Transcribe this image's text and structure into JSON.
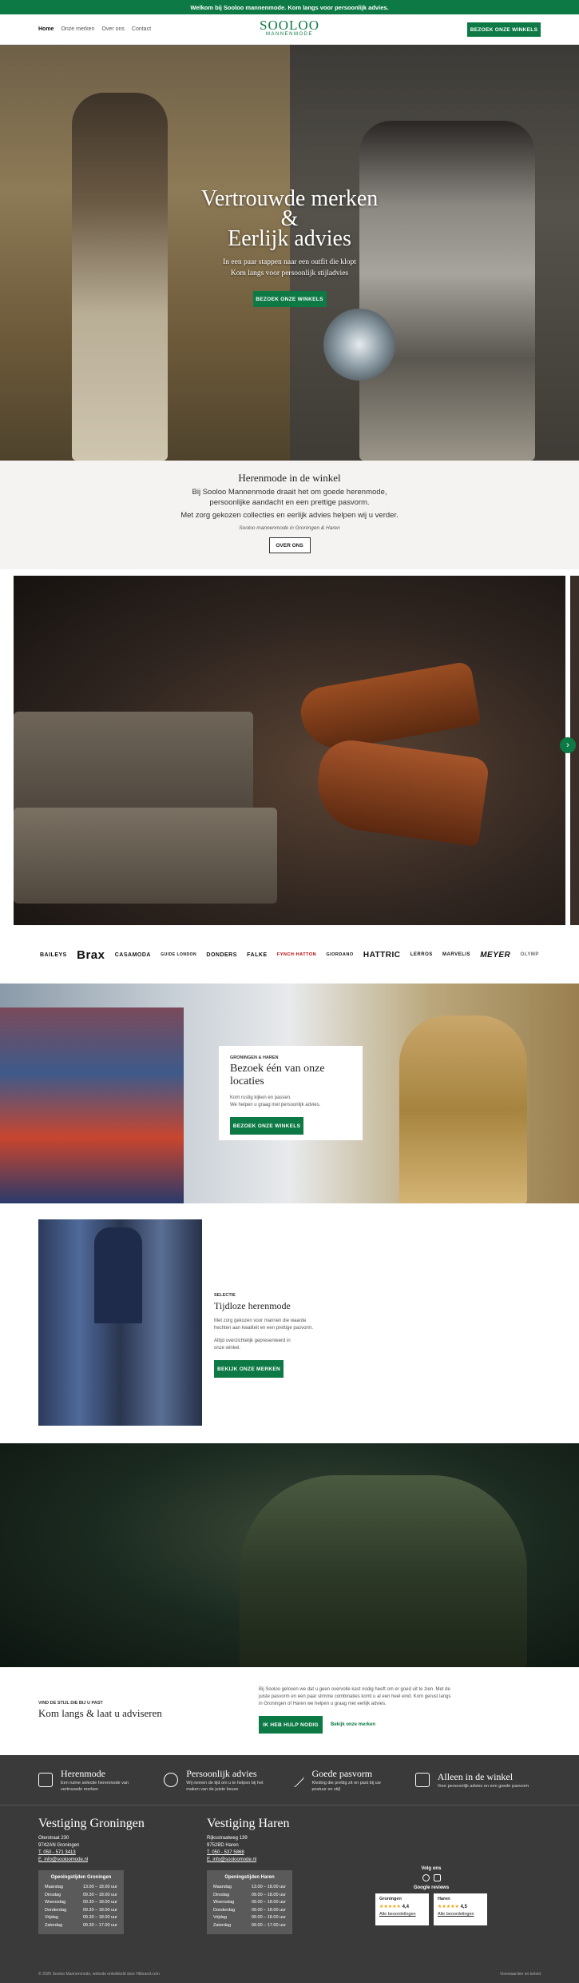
{
  "topbar": {
    "text": "Welkom bij Sooloo mannenmode. Kom langs voor persoonlijk advies."
  },
  "nav": {
    "links": [
      "Home",
      "Onze merken",
      "Over ons",
      "Contact"
    ],
    "logo_name": "SOOLOO",
    "logo_tagline": "MANNENMODE",
    "cta": "BEZOEK ONZE WINKELS"
  },
  "hero": {
    "title_l1": "Vertrouwde merken",
    "title_l2": "&",
    "title_l3": "Eerlijk advies",
    "sub_l1": "In een paar stappen naar een outfit die klopt",
    "sub_l2": "Kom langs voor persoonlijk stijladvies",
    "cta": "BEZOEK ONZE WINKELS"
  },
  "intro": {
    "heading": "Herenmode in de winkel",
    "p1": "Bij Sooloo Mannenmode draait het om goede herenmode,",
    "p2": "persoonlijke aandacht en een prettige pasvorm.",
    "p3": "Met zorg gekozen collecties en eerlijk advies helpen wij u verder.",
    "signature": "Sooloo mannenmode in Groningen & Haren",
    "cta": "OVER ONS"
  },
  "slider": {
    "next_arrow": "›"
  },
  "brands": [
    "BAILEYS",
    "Brax",
    "CASAMODA",
    "GUIDE LONDON",
    "DONDERS",
    "FALKE",
    "FYNCH·HATTON",
    "GIORDANO",
    "HATTRIC",
    "LERROS",
    "MARVELIS",
    "MEYER",
    "OLYMP"
  ],
  "visit": {
    "kicker": "GRONINGEN & HAREN",
    "heading": "Bezoek één van onze locaties",
    "p1": "Kom rustig kijken en passen.",
    "p2": "We helpen u graag met persoonlijk advies.",
    "cta": "BEZOEK ONZE WINKELS"
  },
  "feature": {
    "kicker": "SELECTIE",
    "heading": "Tijdloze herenmode",
    "p1": "Met zorg gekozen voor mannen die waarde",
    "p2": "hechten aan kwaliteit en een prettige pasvorm.",
    "p3": "Altijd overzichtelijk gepresenteerd in",
    "p4": "onze winkel.",
    "cta": "BEKIJK ONZE MERKEN"
  },
  "advice": {
    "kicker": "VIND DE STIJL DIE BIJ U PAST",
    "heading": "Kom langs & laat u adviseren",
    "p1": "Bij Sooloo geloven we dat u geen overvolle kast nodig heeft om er goed uit te zien. Met de",
    "p2": "juiste pasvorm en een paar slimme combinaties komt u al een heel eind. Kom gerust langs",
    "p3": "in Groningen of Haren we helpen u graag met eerlijk advies.",
    "cta": "IK HEB HULP NODIG",
    "link": "Bekijk onze merken"
  },
  "usps": [
    {
      "title": "Herenmode",
      "desc1": "Een ruime selectie herenmode van",
      "desc2": "vertrouwde merken"
    },
    {
      "title": "Persoonlijk advies",
      "desc1": "Wij nemen de tijd om u te helpen bij het",
      "desc2": "maken van de juiste keuze"
    },
    {
      "title": "Goede pasvorm",
      "desc1": "Kleding die prettig zit en past bij uw",
      "desc2": "postuur en stijl"
    },
    {
      "title": "Alleen in de winkel",
      "desc1": "Voor persoonlijk advies en een goede pasvorm",
      "desc2": ""
    }
  ],
  "footer": {
    "groningen": {
      "title": "Vestiging Groningen",
      "street": "Oterstraat 230",
      "city": "9742AN Groningen",
      "phone": "T. 050 - 571 3413",
      "email": "E. info@sooloomode.nl",
      "hours_title": "Openingstijden Groningen",
      "hours": [
        [
          "Maandag",
          "13.00 – 18.00 uur"
        ],
        [
          "Dinsdag",
          "09.30 – 18.00 uur"
        ],
        [
          "Woensdag",
          "09.30 – 18.00 uur"
        ],
        [
          "Donderdag",
          "09.30 – 18.00 uur"
        ],
        [
          "Vrijdag",
          "09.30 – 18.00 uur"
        ],
        [
          "Zaterdag",
          "09.30 – 17.00 uur"
        ]
      ]
    },
    "haren": {
      "title": "Vestiging Haren",
      "street": "Rijksstraatweg 139",
      "city": "9752BD Haren",
      "phone": "T. 050 - 537 5868",
      "email": "E. info@sooloomode.nl",
      "hours_title": "Openingstijden Haren",
      "hours": [
        [
          "Maandag",
          "13.00 – 18.00 uur"
        ],
        [
          "Dinsdag",
          "09.00 – 18.00 uur"
        ],
        [
          "Woensdag",
          "09.00 – 18.00 uur"
        ],
        [
          "Donderdag",
          "09.00 – 18.00 uur"
        ],
        [
          "Vrijdag",
          "09.00 – 18.00 uur"
        ],
        [
          "Zaterdag",
          "09.00 – 17.00 uur"
        ]
      ]
    },
    "follow": "Volg ons",
    "google_reviews": "Google reviews",
    "reviews": [
      {
        "name": "Groningen",
        "stars": "★★★★★",
        "score": "4,4",
        "link": "Alle beoordelingen"
      },
      {
        "name": "Haren",
        "stars": "★★★★★",
        "score": "4,5",
        "link": "Alle beoordelingen"
      }
    ],
    "copyright": "© 2025 Sooloo Mannenmode, website ontwikkeld door Hilbrand.com",
    "legal": "Voorwaarden en beleid"
  }
}
